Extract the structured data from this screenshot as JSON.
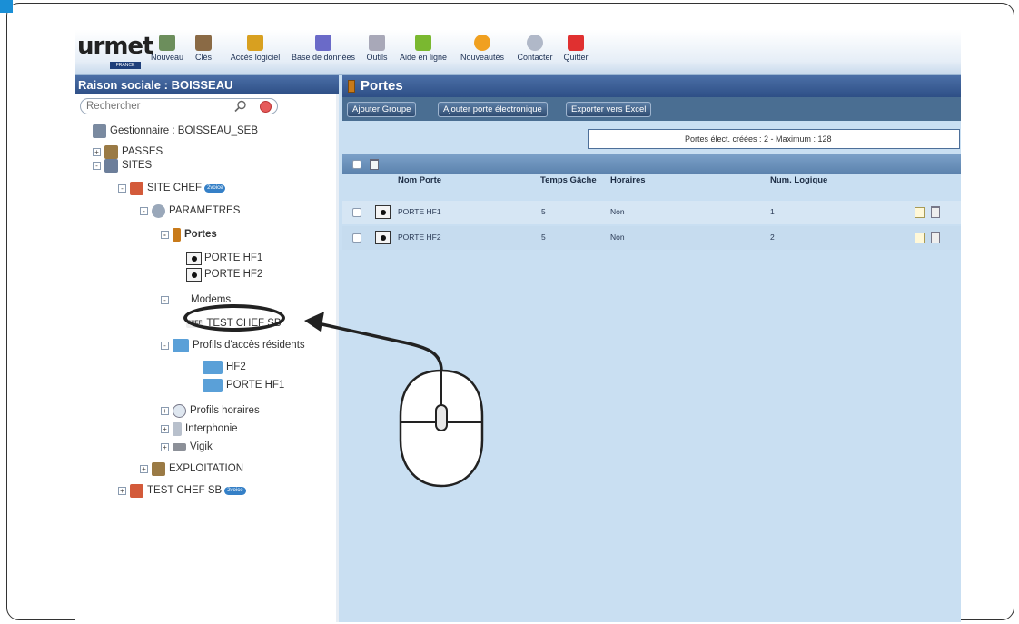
{
  "corner_tag": "",
  "app": {
    "logo": {
      "word": "urmet",
      "sub": "FRANCE"
    },
    "toolbar": [
      {
        "label": "Nouveau",
        "icon": "new-icon",
        "color": "#6c8e5c"
      },
      {
        "label": "Clés",
        "icon": "keys-icon",
        "color": "#8a6a45"
      },
      {
        "label": "Accès logiciel",
        "icon": "users-icon",
        "color": "#d8a020"
      },
      {
        "label": "Base de données",
        "icon": "database-icon",
        "color": "#6a6ac8"
      },
      {
        "label": "Outils",
        "icon": "tools-icon",
        "color": "#a8a8b8"
      },
      {
        "label": "Aide en ligne",
        "icon": "help-icon",
        "color": "#7ab830"
      },
      {
        "label": "Nouveautés",
        "icon": "news-icon",
        "color": "#f0a020"
      },
      {
        "label": "Contacter",
        "icon": "contact-icon",
        "color": "#b0b8c8"
      },
      {
        "label": "Quitter",
        "icon": "quit-icon",
        "color": "#e03030"
      }
    ]
  },
  "sidebar": {
    "title": "Raison sociale : BOISSEAU",
    "search_placeholder": "Rechercher",
    "tree": [
      {
        "label": "Gestionnaire : BOISSEAU_SEB",
        "icon": "manager-icon",
        "toggle": ""
      },
      {
        "label": "PASSES",
        "icon": "passes-icon",
        "toggle": "+"
      },
      {
        "label": "SITES",
        "icon": "sites-icon",
        "toggle": "-"
      },
      {
        "label": "SITE CHEF",
        "icon": "site-icon",
        "toggle": "-",
        "badge": "2voice"
      },
      {
        "label": "PARAMETRES",
        "icon": "parameters-icon",
        "toggle": "-"
      },
      {
        "label": "Portes",
        "icon": "door-icon",
        "toggle": "-"
      },
      {
        "label": "PORTE HF1",
        "icon": "door-reader-icon",
        "toggle": ""
      },
      {
        "label": "PORTE HF2",
        "icon": "door-reader-icon",
        "toggle": ""
      },
      {
        "label": "Modems",
        "icon": "",
        "toggle": "-"
      },
      {
        "label": "TEST CHEF SB",
        "icon": "chef-icon",
        "toggle": "",
        "prefix": "CHEF"
      },
      {
        "label": "Profils d'accès résidents",
        "icon": "profile-icon",
        "toggle": "-"
      },
      {
        "label": "HF2",
        "icon": "profile-item-icon",
        "toggle": ""
      },
      {
        "label": "PORTE HF1",
        "icon": "profile-item-icon",
        "toggle": ""
      },
      {
        "label": "Profils horaires",
        "icon": "clock-icon",
        "toggle": "+"
      },
      {
        "label": "Interphonie",
        "icon": "intercom-icon",
        "toggle": "+"
      },
      {
        "label": "Vigik",
        "icon": "vigik-icon",
        "toggle": "+"
      },
      {
        "label": "EXPLOITATION",
        "icon": "exploitation-icon",
        "toggle": "+"
      },
      {
        "label": "TEST CHEF SB",
        "icon": "site-icon",
        "toggle": "+",
        "badge": "2voice"
      }
    ]
  },
  "main": {
    "title": "Portes",
    "buttons": {
      "add_group": "Ajouter Groupe",
      "add_door": "Ajouter porte électronique",
      "export": "Exporter vers Excel"
    },
    "info": "Portes élect. créées : 2 - Maximum : 128",
    "columns": {
      "name": "Nom Porte",
      "strike_time": "Temps Gâche",
      "schedule": "Horaires",
      "logical_num": "Num. Logique"
    },
    "rows": [
      {
        "name": "PORTE HF1",
        "strike_time": "5",
        "schedule": "Non",
        "logical_num": "1"
      },
      {
        "name": "PORTE HF2",
        "strike_time": "5",
        "schedule": "Non",
        "logical_num": "2"
      }
    ]
  }
}
